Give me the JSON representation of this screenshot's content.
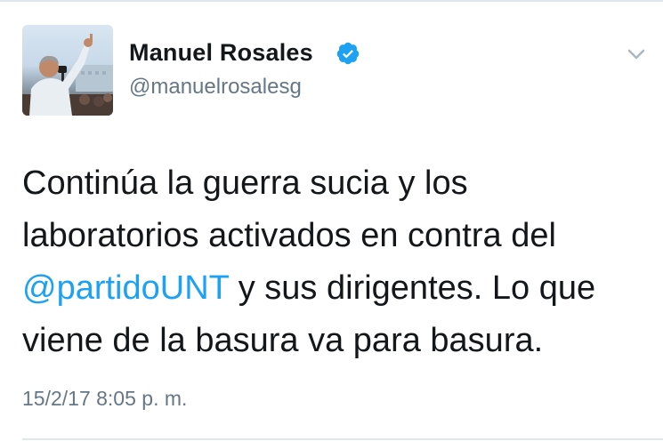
{
  "author": {
    "name": "Manuel Rosales",
    "handle": "@manuelrosalesg",
    "verified": true
  },
  "tweet": {
    "text_before": "Continúa la guerra sucia y los laboratorios activados en contra del ",
    "mention": "@partidoUNT",
    "text_after": " y sus dirigentes. Lo que viene de la basura va para basura.",
    "timestamp": "15/2/17 8:05 p. m."
  },
  "icons": {
    "verified": "verified-badge-icon",
    "menu": "chevron-down-icon"
  },
  "colors": {
    "text": "#14171a",
    "secondary": "#657786",
    "link": "#1da1f2",
    "verified": "#1da1f2",
    "divider": "#e1e8ed"
  }
}
